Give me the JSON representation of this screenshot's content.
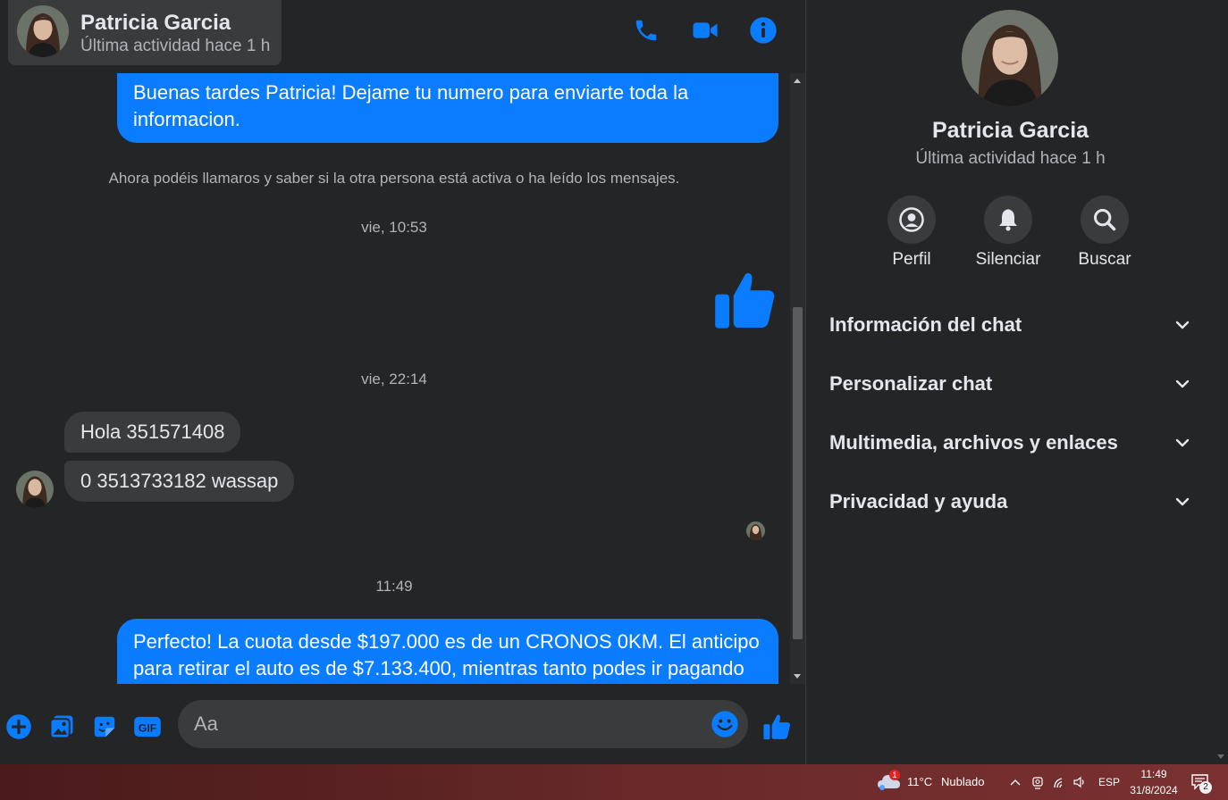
{
  "contact": {
    "name": "Patricia Garcia",
    "status": "Última actividad hace 1 h"
  },
  "header": {
    "call_icon": "phone-icon",
    "video_icon": "video-camera-icon",
    "info_icon": "info-icon"
  },
  "messages": {
    "out_1": "Buenas tardes Patricia! Dejame tu numero para enviarte toda la informacion.",
    "system_note": "Ahora podéis llamaros y saber si la otra persona está activa o ha leído los mensajes.",
    "ts_1": "vie, 10:53",
    "ts_2": "vie, 22:14",
    "in_1": "Hola 351571408",
    "in_2": "0 3513733182 wassap",
    "ts_3": "11:49",
    "out_2": "Perfecto! La cuota desde $197.000 es de un CRONOS 0KM. El anticipo para retirar el auto es de $7.133.400, mientras tanto podes ir pagando"
  },
  "composer": {
    "placeholder": "Aa"
  },
  "panel": {
    "name": "Patricia Garcia",
    "status": "Última actividad hace 1 h",
    "actions": [
      {
        "label": "Perfil",
        "icon": "profile-icon"
      },
      {
        "label": "Silenciar",
        "icon": "bell-icon"
      },
      {
        "label": "Buscar",
        "icon": "search-icon"
      }
    ],
    "sections": [
      {
        "title": "Información del chat"
      },
      {
        "title": "Personalizar chat"
      },
      {
        "title": "Multimedia, archivos y enlaces"
      },
      {
        "title": "Privacidad y ayuda"
      }
    ]
  },
  "taskbar": {
    "weather_temp": "11°C",
    "weather_desc": "Nublado",
    "weather_badge": "1",
    "language": "ESP",
    "time": "11:49",
    "date": "31/8/2024",
    "notification_count": "2"
  },
  "colors": {
    "accent": "#0a7cff",
    "background": "#242526",
    "surface": "#3a3b3c",
    "text_primary": "#e4e6eb",
    "text_secondary": "#b0b3b8"
  }
}
